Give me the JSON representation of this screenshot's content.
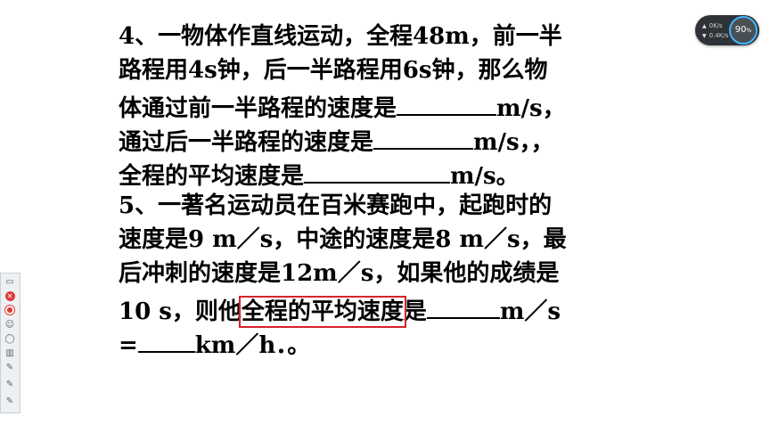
{
  "document": {
    "lines": [
      "4、一物体作直线运动，全程48m，前一半",
      "路程用4s钟，后一半路程用6s钟，那么物",
      [
        "体通过前一半路程的速度是",
        "m/s，"
      ],
      [
        "通过后一半路程的速度是",
        "m/s，，"
      ],
      [
        "全程的平均速度是",
        "m/s。"
      ],
      "5、一著名运动员在百米赛跑中，起跑时的",
      "速度是9 m／s，中途的速度是8 m／s，最",
      "后冲刺的速度是12m／s，如果他的成绩是",
      [
        "10 s，则他",
        "全程的平均速度",
        "是",
        "m／s"
      ],
      [
        "=",
        "km／h．。"
      ]
    ]
  },
  "widget": {
    "upload_speed": "0K/s",
    "download_speed": "0.4K/s",
    "percent": "90",
    "percent_unit": "%"
  },
  "toolbar": {
    "tools": [
      "page-icon",
      "close-icon",
      "record-icon",
      "user-icon",
      "mouse-icon",
      "trash-icon",
      "pen-icon",
      "pen-icon",
      "pen-icon"
    ]
  },
  "colors": {
    "highlight_box": "#d4242a",
    "widget_bg": "#2f3337",
    "gauge_ring": "#3fb6ff"
  }
}
